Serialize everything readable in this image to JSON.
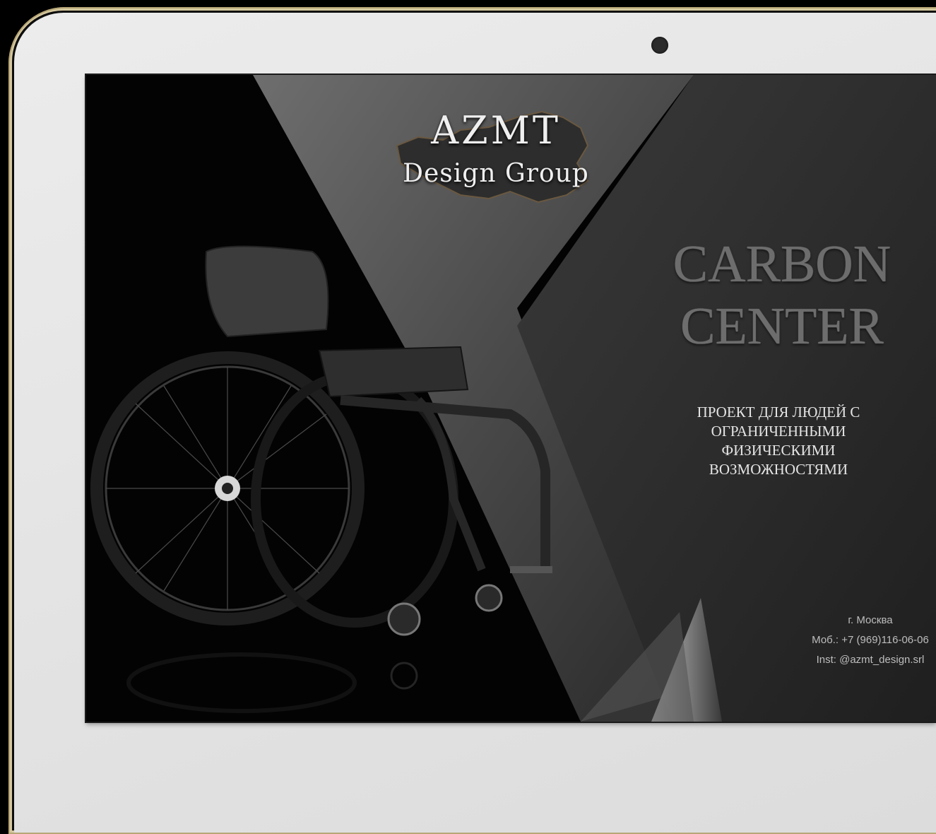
{
  "device": {
    "camera_icon": "camera-dot"
  },
  "slide": {
    "logo": {
      "title": "AZMT",
      "subtitle": "Design Group",
      "map_icon": "russia-map-icon"
    },
    "headline_line1": "CARBON",
    "headline_line2": "CENTER",
    "tagline": [
      "ПРОЕКТ ДЛЯ ЛЮДЕЙ С",
      "ОГРАНИЧЕННЫМИ",
      "ФИЗИЧЕСКИМИ",
      "ВОЗМОЖНОСТЯМИ"
    ],
    "contacts": {
      "city": "г. Москва",
      "phone": "Моб.: +7 (969)116-06-06",
      "instagram": "Inst: @azmt_design.srl"
    },
    "image": "wheelchair-photo"
  },
  "colors": {
    "bezel_gold": "#d6c9a0",
    "bezel_face": "#e6e6e6",
    "screen_bg": "#030303",
    "headline": "#6d6d6d"
  }
}
